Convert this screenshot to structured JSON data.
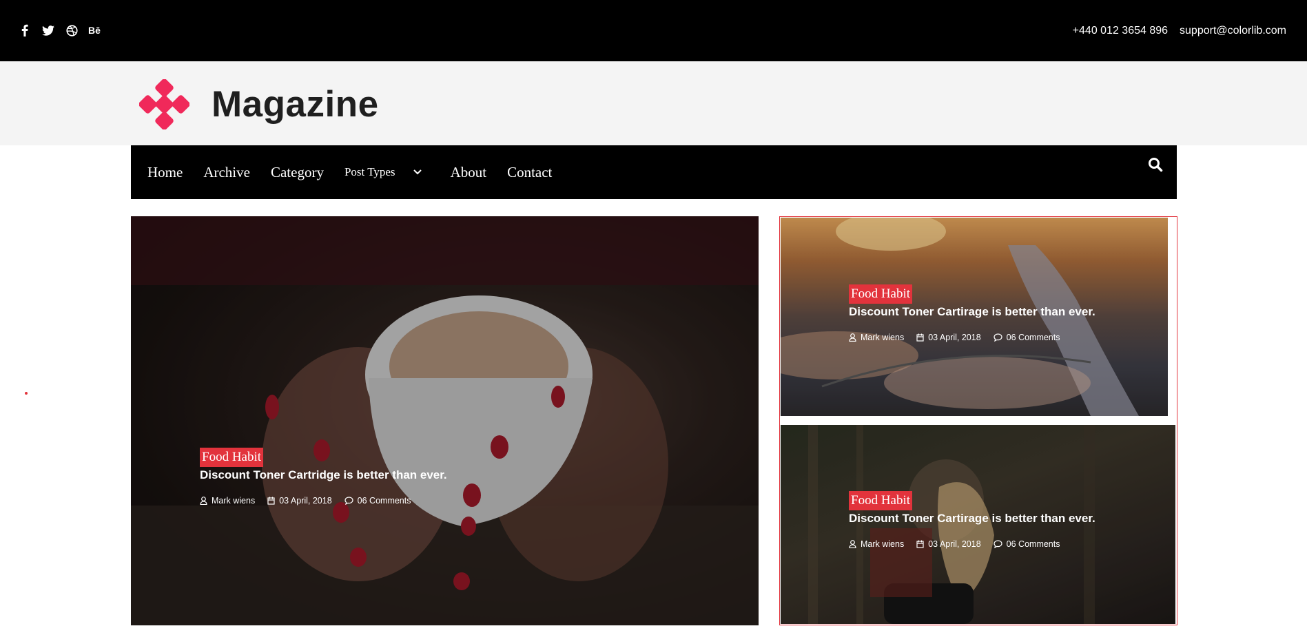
{
  "topbar": {
    "social": [
      "facebook-icon",
      "twitter-icon",
      "dribbble-icon",
      "behance-icon"
    ],
    "behance_label": "Bē",
    "phone": "+440 012 3654 896",
    "email": "support@colorlib.com"
  },
  "brand": {
    "name": "Magazine",
    "accent": "#f0295a"
  },
  "nav": {
    "items": [
      "Home",
      "Archive",
      "Category",
      "Post Types",
      "About",
      "Contact"
    ]
  },
  "posts": [
    {
      "category": "Food Habit",
      "title": "Discount Toner Cartridge is better than ever.",
      "author": "Mark wiens",
      "date": "03 April, 2018",
      "comments": "06 Comments"
    },
    {
      "category": "Food Habit",
      "title": "Discount Toner Cartirage is better than ever.",
      "author": "Mark wiens",
      "date": "03 April, 2018",
      "comments": "06 Comments"
    },
    {
      "category": "Food Habit",
      "title": "Discount Toner Cartirage is better than ever.",
      "author": "Mark wiens",
      "date": "03 April, 2018",
      "comments": "06 Comments"
    }
  ],
  "colors": {
    "accent": "#e2333c",
    "dark": "#000000",
    "light": "#f4f4f4"
  }
}
